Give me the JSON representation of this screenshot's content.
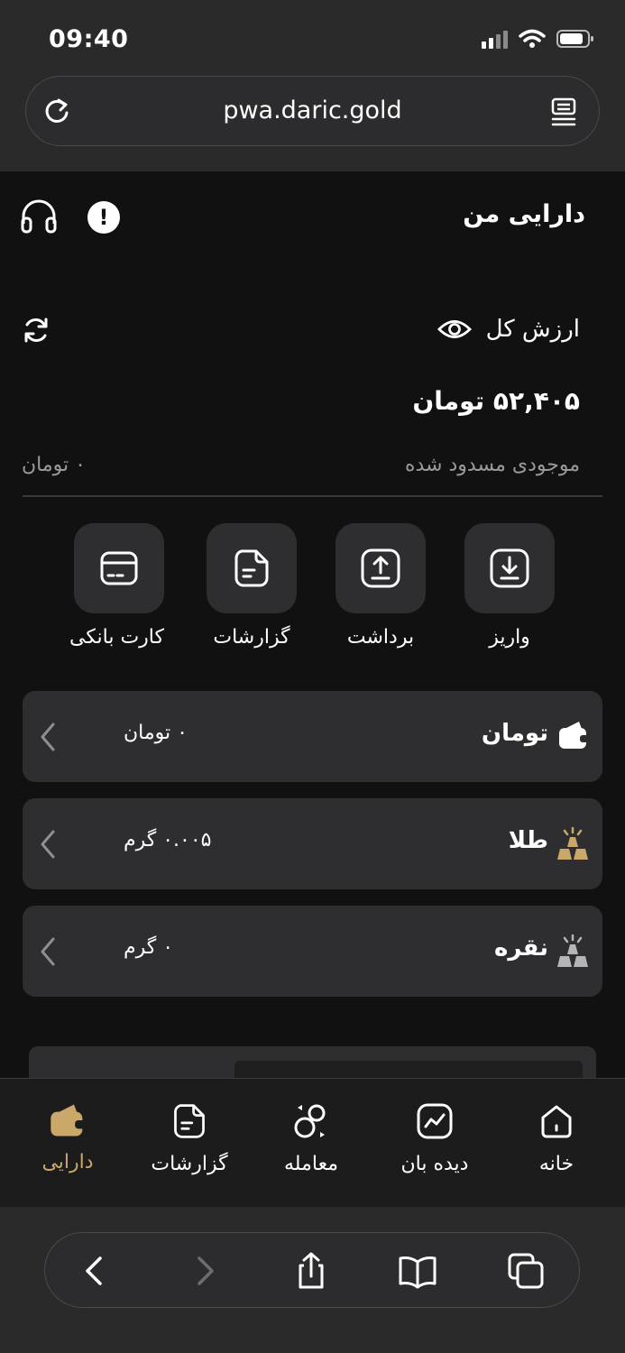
{
  "status_bar": {
    "time": "09:40"
  },
  "browser": {
    "url": "pwa.daric.gold"
  },
  "header": {
    "title": "دارایی من"
  },
  "summary": {
    "total_label": "ارزش کل",
    "total_value": "۵۲,۴۰۵ تومان",
    "blocked_label": "موجودی مسدود شده",
    "blocked_value": "۰ تومان"
  },
  "actions": [
    {
      "label": "واریز",
      "icon": "download-icon"
    },
    {
      "label": "برداشت",
      "icon": "upload-icon"
    },
    {
      "label": "گزارشات",
      "icon": "document-icon"
    },
    {
      "label": "کارت بانکی",
      "icon": "card-icon"
    }
  ],
  "assets": [
    {
      "name": "تومان",
      "value": "۰ تومان",
      "icon": "wallet-icon"
    },
    {
      "name": "طلا",
      "value": "۰.۰۰۵ گرم",
      "icon": "gold-bars-icon"
    },
    {
      "name": "نقره",
      "value": "۰ گرم",
      "icon": "silver-bars-icon"
    }
  ],
  "tabbar": {
    "active": "دارایی",
    "items": [
      {
        "label": "خانه",
        "icon": "home-icon"
      },
      {
        "label": "دیده بان",
        "icon": "chart-icon"
      },
      {
        "label": "معامله",
        "icon": "trade-icon"
      },
      {
        "label": "گزارشات",
        "icon": "document-icon"
      },
      {
        "label": "دارایی",
        "icon": "wallet-icon"
      }
    ]
  },
  "colors": {
    "background": "#111111",
    "card": "#2e2e30",
    "accent_gold": "#c9a86a",
    "muted_text": "#9a9a9c"
  }
}
